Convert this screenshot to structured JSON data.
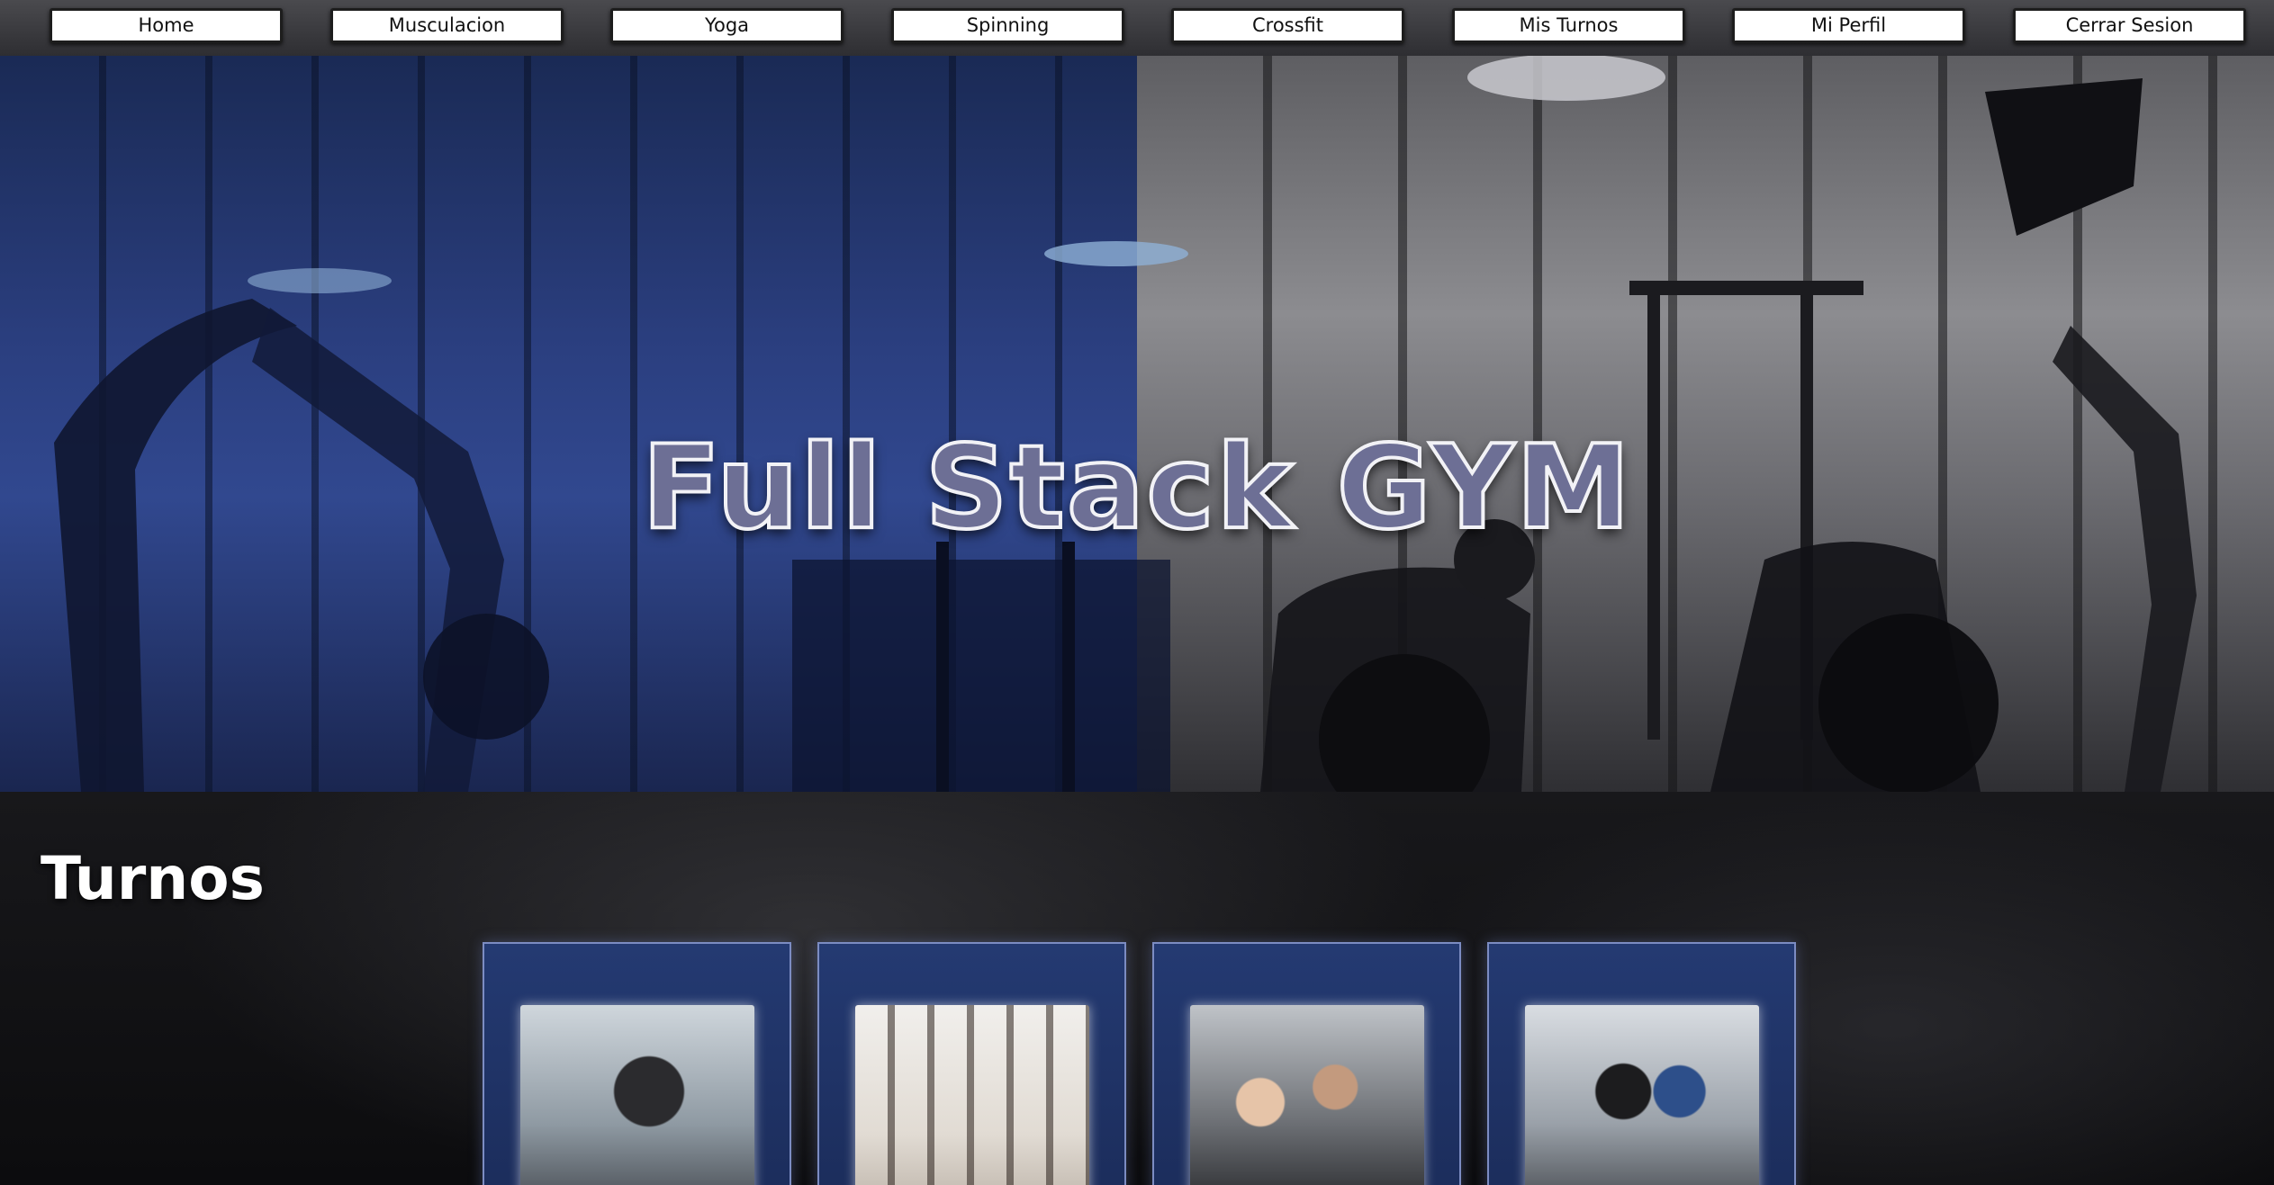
{
  "nav": {
    "items": [
      {
        "label": "Home"
      },
      {
        "label": "Musculacion"
      },
      {
        "label": "Yoga"
      },
      {
        "label": "Spinning"
      },
      {
        "label": "Crossfit"
      },
      {
        "label": "Mis Turnos"
      },
      {
        "label": "Mi Perfil"
      },
      {
        "label": "Cerrar Sesion"
      }
    ]
  },
  "hero": {
    "title": "Full Stack GYM"
  },
  "turnos": {
    "title": "Turnos",
    "cards": [
      {
        "image": "musculacion-photo"
      },
      {
        "image": "yoga-photo"
      },
      {
        "image": "spinning-photo"
      },
      {
        "image": "crossfit-photo"
      }
    ]
  },
  "colors": {
    "nav_bg": "#3c3c40",
    "hero_left_tint": "#2b3f80",
    "card_bg": "#243a72",
    "card_border": "#7c8cc2",
    "title_fill": "#6d6f95"
  }
}
